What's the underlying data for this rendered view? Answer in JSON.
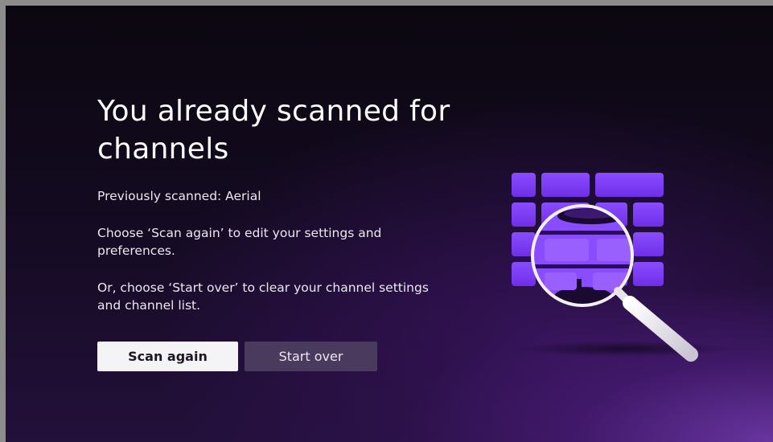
{
  "heading": "You already scanned for channels",
  "previously_scanned": "Previously scanned: Aerial",
  "scan_again_hint": "Choose ‘Scan again’ to edit your settings and preferences.",
  "start_over_hint": "Or, choose ‘Start over’ to clear your channel settings and channel list.",
  "buttons": {
    "scan_again": "Scan again",
    "start_over": "Start over"
  },
  "colors": {
    "accent_purple": "#7a3cf5",
    "button_primary_bg": "#f4f3f6",
    "button_secondary_bg": "#4a3a5e"
  },
  "illustration_icon": "magnifying-glass-over-channel-grid"
}
